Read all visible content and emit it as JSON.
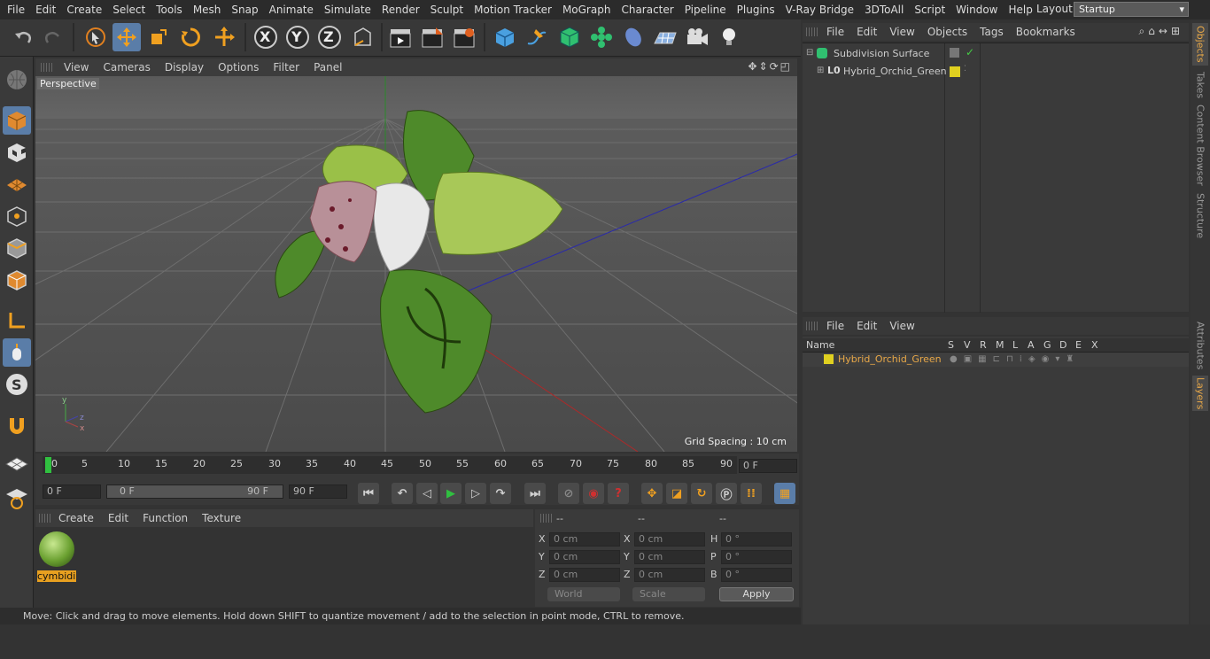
{
  "menubar": {
    "items": [
      "File",
      "Edit",
      "Create",
      "Select",
      "Tools",
      "Mesh",
      "Snap",
      "Animate",
      "Simulate",
      "Render",
      "Sculpt",
      "Motion Tracker",
      "MoGraph",
      "Character",
      "Pipeline",
      "Plugins",
      "V-Ray Bridge",
      "3DToAll",
      "Script",
      "Window",
      "Help"
    ],
    "layout_label": "Layout:",
    "layout_value": "Startup"
  },
  "toolbar": {
    "axis_x": "X",
    "axis_y": "Y",
    "axis_z": "Z"
  },
  "viewport": {
    "menu": [
      "View",
      "Cameras",
      "Display",
      "Options",
      "Filter",
      "Panel"
    ],
    "label": "Perspective",
    "grid_spacing": "Grid Spacing : 10 cm"
  },
  "timeline": {
    "ticks": [
      "0",
      "5",
      "10",
      "15",
      "20",
      "25",
      "30",
      "35",
      "40",
      "45",
      "50",
      "55",
      "60",
      "65",
      "70",
      "75",
      "80",
      "85",
      "90"
    ],
    "current_frame": "0 F"
  },
  "playbar": {
    "start": "0 F",
    "range_start": "0 F",
    "range_end": "90 F",
    "end": "90 F"
  },
  "material_panel": {
    "menu": [
      "Create",
      "Edit",
      "Function",
      "Texture"
    ],
    "material_name": "cymbidi"
  },
  "coords": {
    "header": [
      "--",
      "--",
      "--"
    ],
    "rows": [
      {
        "l1": "X",
        "v1": "0 cm",
        "l2": "X",
        "v2": "0 cm",
        "l3": "H",
        "v3": "0 °"
      },
      {
        "l1": "Y",
        "v1": "0 cm",
        "l2": "Y",
        "v2": "0 cm",
        "l3": "P",
        "v3": "0 °"
      },
      {
        "l1": "Z",
        "v1": "0 cm",
        "l2": "Z",
        "v2": "0 cm",
        "l3": "B",
        "v3": "0 °"
      }
    ],
    "world": "World",
    "scale": "Scale",
    "apply": "Apply"
  },
  "status": {
    "text": "Move: Click and drag to move elements. Hold down SHIFT to quantize movement / add to the selection in point mode, CTRL to remove."
  },
  "objects": {
    "menu": [
      "File",
      "Edit",
      "View",
      "Objects",
      "Tags",
      "Bookmarks"
    ],
    "items": [
      {
        "name": "Subdivision Surface"
      },
      {
        "name": "Hybrid_Orchid_Green"
      }
    ]
  },
  "layers": {
    "menu": [
      "File",
      "Edit",
      "View"
    ],
    "columns": [
      "Name",
      "S",
      "V",
      "R",
      "M",
      "L",
      "A",
      "G",
      "D",
      "E",
      "X"
    ],
    "rows": [
      {
        "name": "Hybrid_Orchid_Green"
      }
    ]
  },
  "right_tabs": [
    "Objects",
    "Takes",
    "Content Browser",
    "Structure",
    "Attributes",
    "Layers"
  ],
  "colors": {
    "accent": "#5a7da8",
    "layer_yellow": "#e0d020",
    "layer_text": "#e8a848"
  }
}
